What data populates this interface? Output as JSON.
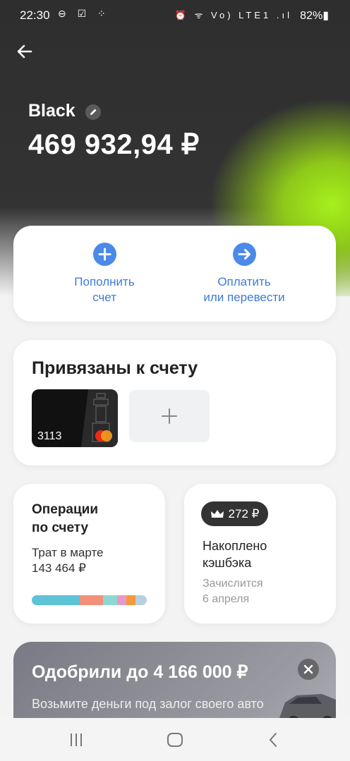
{
  "status_bar": {
    "time": "22:30",
    "left_icons": "⊖ ☑ ⁘",
    "right_icons": "⏰ ᯤ Vo) LTE1 .ıl",
    "battery": "82%▮"
  },
  "account": {
    "name": "Black",
    "balance": "469 932,94 ₽"
  },
  "actions": [
    {
      "line1": "Пополнить",
      "line2": "счет",
      "icon": "plus-icon"
    },
    {
      "line1": "Оплатить",
      "line2": "или перевести",
      "icon": "arrow-right-icon"
    }
  ],
  "linked": {
    "title": "Привязаны к счету",
    "card_number": "3113",
    "add_icon": "+"
  },
  "operations": {
    "title_line1": "Операции",
    "title_line2": "по счету",
    "subtitle_line1": "Трат в марте",
    "subtitle_line2": "143 464 ₽",
    "segments": [
      {
        "color": "#5ec3d6",
        "share": 0.42
      },
      {
        "color": "#f1917a",
        "share": 0.2
      },
      {
        "color": "#8fd7d3",
        "share": 0.12
      },
      {
        "color": "#e69ac8",
        "share": 0.08
      },
      {
        "color": "#f29a3d",
        "share": 0.08
      },
      {
        "color": "#b8cfe0",
        "share": 0.1
      }
    ]
  },
  "cashback": {
    "amount": "272 ₽",
    "title_line1": "Накоплено",
    "title_line2": "кэшбэка",
    "note_line1": "Зачислится",
    "note_line2": "6 апреля"
  },
  "promo": {
    "title": "Одобрили до 4 166 000 ₽",
    "text": "Возьмите деньги под залог своего авто или авто другого человека"
  },
  "colors": {
    "accent": "#4a8ae8",
    "lime": "#a6f01c",
    "dark": "#2e2e2e"
  }
}
